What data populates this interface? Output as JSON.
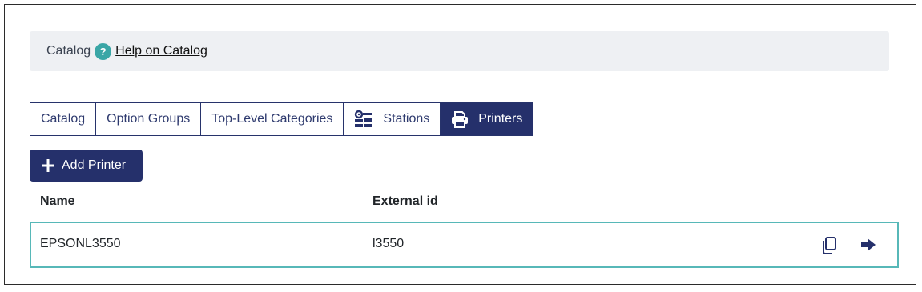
{
  "breadcrumb": {
    "label": "Catalog",
    "help_icon": "?",
    "help_link": "Help on Catalog"
  },
  "tabs": [
    {
      "label": "Catalog",
      "active": false
    },
    {
      "label": "Option Groups",
      "active": false
    },
    {
      "label": "Top-Level Categories",
      "active": false
    },
    {
      "label": "Stations",
      "icon": "stations-icon",
      "active": false
    },
    {
      "label": "Printers",
      "icon": "printer-icon",
      "active": true
    }
  ],
  "actions": {
    "add_label": "Add Printer"
  },
  "table": {
    "columns": [
      "Name",
      "External id"
    ],
    "rows": [
      {
        "name": "EPSONL3550",
        "external_id": "l3550",
        "actions": [
          "copy-icon",
          "arrow-right-icon"
        ]
      }
    ]
  },
  "colors": {
    "primary": "#25306b",
    "accent": "#3aa6a6",
    "row_border": "#57b8b8",
    "crumb_bg": "#eef0f3"
  }
}
